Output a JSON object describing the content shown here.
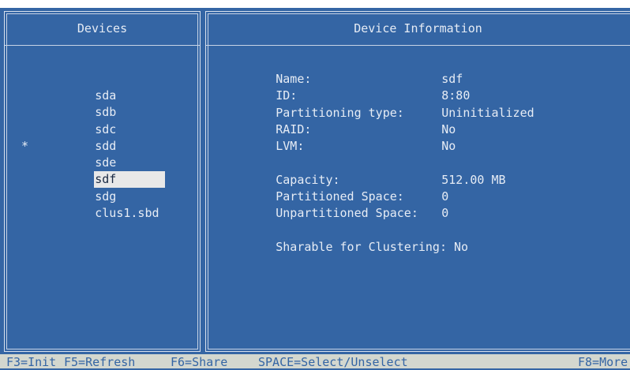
{
  "devices_panel": {
    "title": "Devices",
    "items": [
      {
        "name": "sda",
        "marker": "",
        "selected": false
      },
      {
        "name": "sdb",
        "marker": "",
        "selected": false
      },
      {
        "name": "sdc",
        "marker": "",
        "selected": false
      },
      {
        "name": "sdd",
        "marker": "",
        "selected": false
      },
      {
        "name": "sde",
        "marker": "",
        "selected": false
      },
      {
        "name": "sdf",
        "marker": "*",
        "selected": true
      },
      {
        "name": "sdg",
        "marker": "",
        "selected": false
      },
      {
        "name": "clus1.sbd",
        "marker": "",
        "selected": false
      }
    ]
  },
  "info_panel": {
    "title": "Device Information",
    "name_label": "Name:",
    "name_value": "sdf",
    "id_label": "ID:",
    "id_value": "8:80",
    "partitioning_label": "Partitioning type:",
    "partitioning_value": "Uninitialized",
    "raid_label": "RAID:",
    "raid_value": "No",
    "lvm_label": "LVM:",
    "lvm_value": "No",
    "capacity_label": "Capacity:",
    "capacity_value": "512.00 MB",
    "partitioned_label": "Partitioned Space:",
    "partitioned_value": "0",
    "unpartitioned_label": "Unpartitioned Space:",
    "unpartitioned_value": "0",
    "sharable_label": "Sharable for Clustering:",
    "sharable_value": "No"
  },
  "status_bar": {
    "init": "F3=Init",
    "refresh": "F5=Refresh",
    "share": "F6=Share",
    "select": "SPACE=Select/Unselect",
    "more": "F8=More"
  },
  "colors": {
    "background": "#3465a4",
    "text": "#e6ecf5",
    "status_bar": "#d3d7cf",
    "selection": "#e8e8e8"
  }
}
